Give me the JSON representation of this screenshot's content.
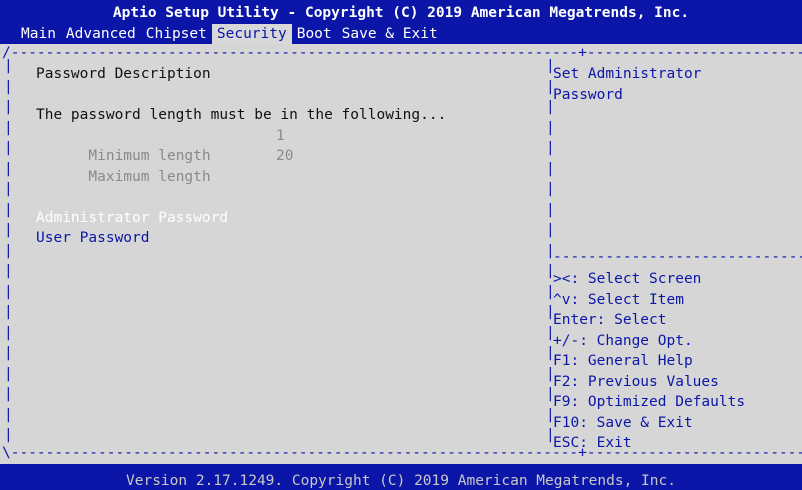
{
  "header": {
    "title": "Aptio Setup Utility - Copyright (C) 2019 American Megatrends, Inc."
  },
  "menu": [
    {
      "label": "Main",
      "active": false
    },
    {
      "label": "Advanced",
      "active": false
    },
    {
      "label": "Chipset",
      "active": false
    },
    {
      "label": "Security",
      "active": true
    },
    {
      "label": "Boot",
      "active": false
    },
    {
      "label": "Save & Exit",
      "active": false
    }
  ],
  "content": {
    "section_title": "Password Description",
    "info": "The password length must be in the following...",
    "min_label": "Minimum length",
    "min_value": "1",
    "max_label": "Maximum length",
    "max_value": "20",
    "admin_password": "Administrator Password",
    "user_password": "User Password"
  },
  "help": {
    "line1": "Set Administrator",
    "line2": "Password"
  },
  "keys": [
    "><: Select Screen",
    "^v: Select Item",
    "Enter: Select",
    "+/-: Change Opt.",
    "F1: General Help",
    "F2: Previous Values",
    "F9: Optimized Defaults",
    "F10: Save & Exit",
    "ESC: Exit"
  ],
  "footer": {
    "version": "Version 2.17.1249. Copyright (C) 2019 American Megatrends, Inc."
  },
  "colors": {
    "bar_blue": "#0b16a8",
    "panel_gray": "#d6d6d6",
    "highlight_white": "#ffffff"
  }
}
